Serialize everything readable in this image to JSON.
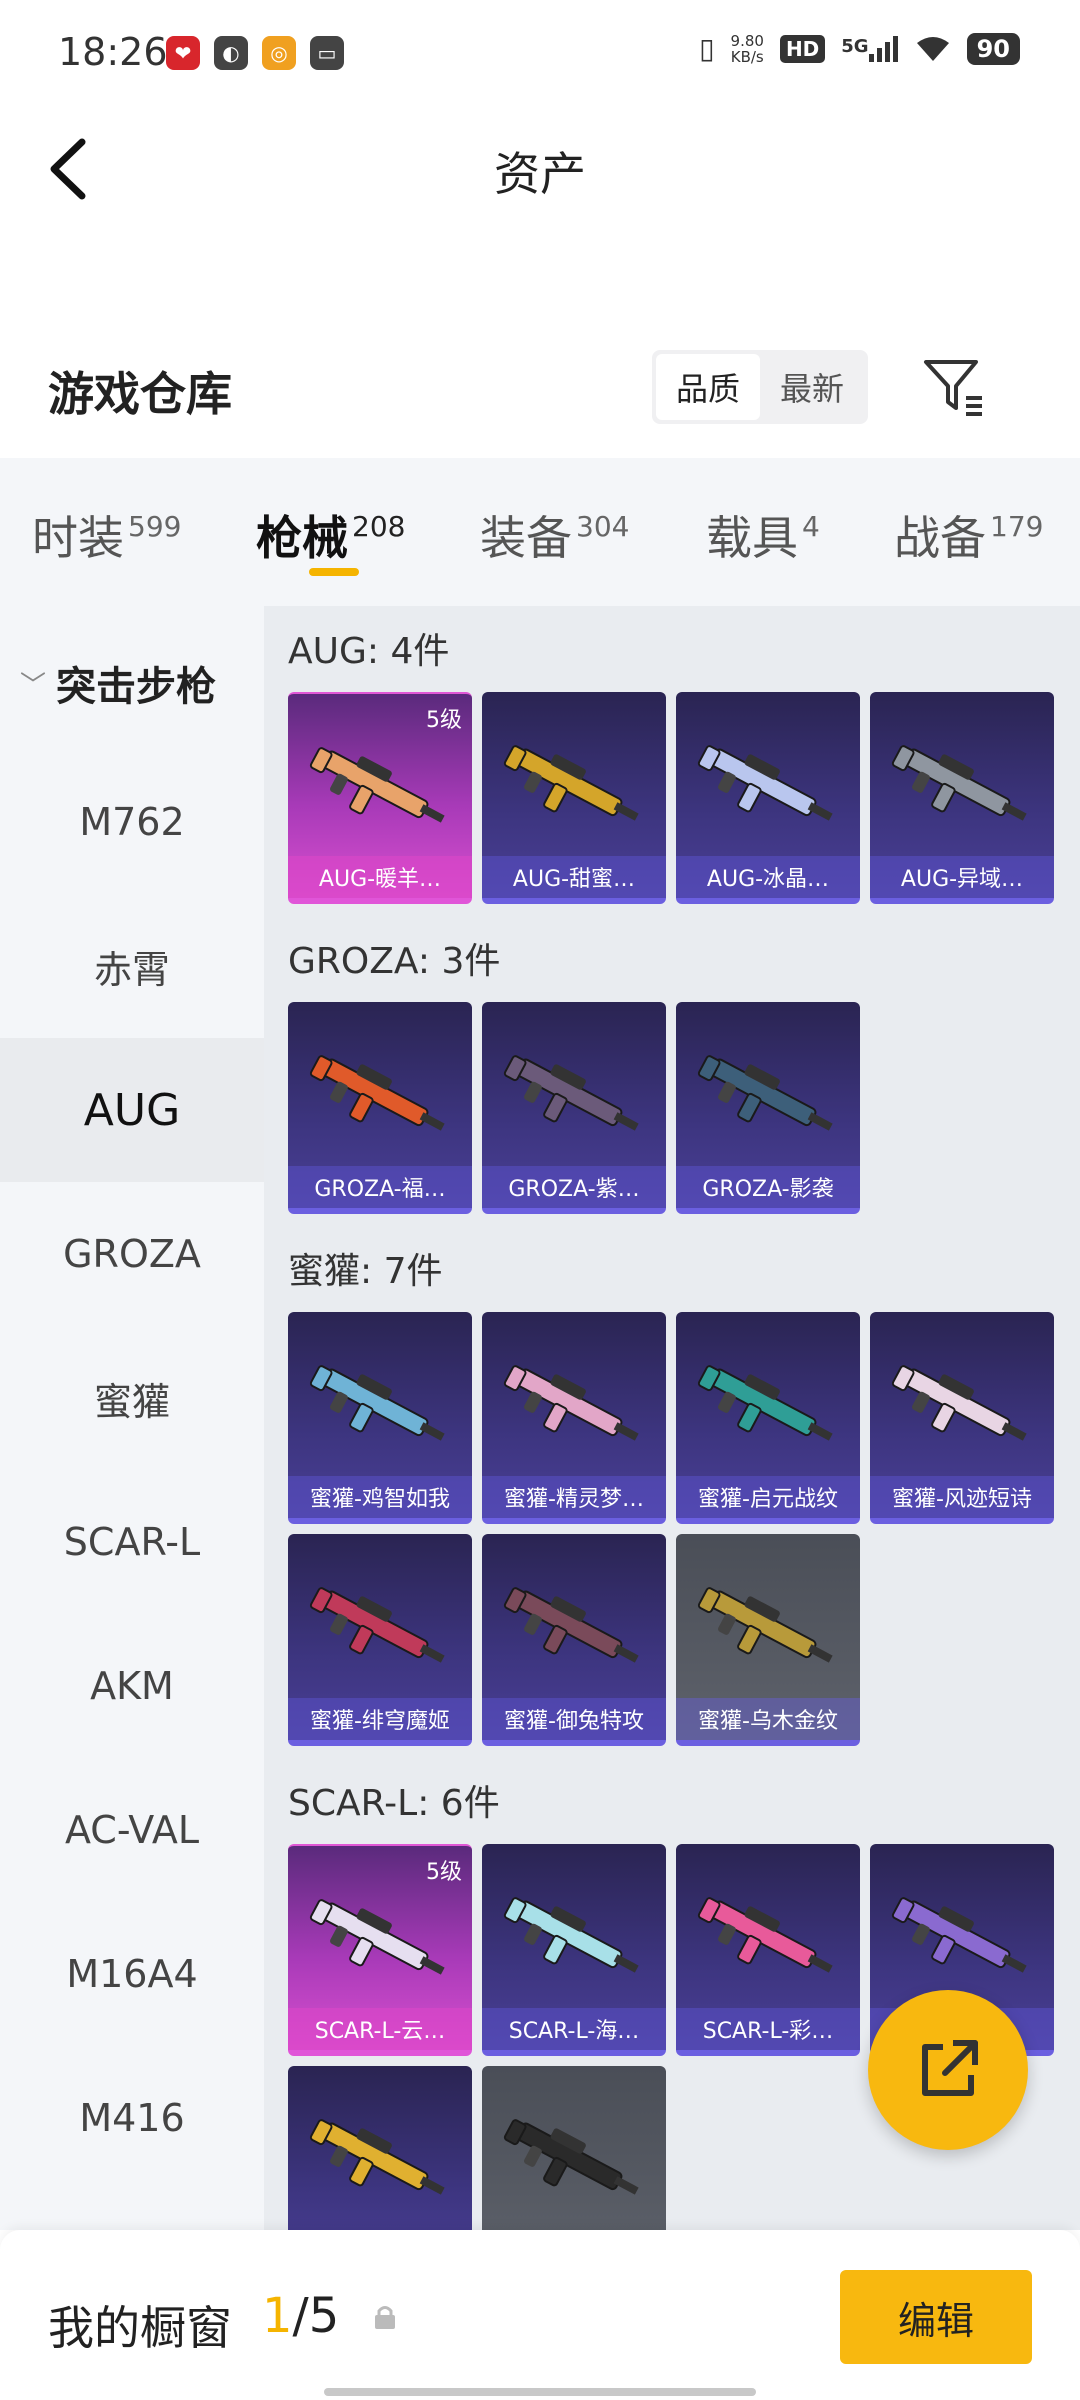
{
  "status": {
    "time": "18:26",
    "speed_value": "9.80",
    "speed_unit": "KB/s",
    "hd": "HD",
    "net": "5G",
    "battery": "90"
  },
  "header": {
    "title": "资产"
  },
  "warehouse": {
    "title": "游戏仓库",
    "sort": [
      "品质",
      "最新"
    ]
  },
  "tabs": [
    {
      "label": "时装",
      "count": "599"
    },
    {
      "label": "枪械",
      "count": "208"
    },
    {
      "label": "装备",
      "count": "304"
    },
    {
      "label": "载具",
      "count": "4"
    },
    {
      "label": "战备",
      "count": "179"
    }
  ],
  "sidebar": {
    "category": "突击步枪",
    "items": [
      "M762",
      "赤霄",
      "AUG",
      "GROZA",
      "蜜獾",
      "SCAR-L",
      "AKM",
      "AC-VAL",
      "M16A4",
      "M416"
    ]
  },
  "sections": [
    {
      "title": "AUG: 4件",
      "items": [
        {
          "label": "AUG-暖羊…",
          "level": "5级",
          "rarity": "pink",
          "color": "#e8a36a"
        },
        {
          "label": "AUG-甜蜜…",
          "level": "",
          "rarity": "purple",
          "color": "#d4a52a"
        },
        {
          "label": "AUG-冰晶…",
          "level": "",
          "rarity": "purple",
          "color": "#b9c6ee"
        },
        {
          "label": "AUG-异域…",
          "level": "",
          "rarity": "purple",
          "color": "#8f96a0"
        }
      ]
    },
    {
      "title": "GROZA: 3件",
      "items": [
        {
          "label": "GROZA-福…",
          "level": "",
          "rarity": "purple",
          "color": "#e05a2a"
        },
        {
          "label": "GROZA-紫…",
          "level": "",
          "rarity": "purple",
          "color": "#6b5a7a"
        },
        {
          "label": "GROZA-影袭",
          "level": "",
          "rarity": "purple",
          "color": "#3d5f7a"
        }
      ]
    },
    {
      "title": "蜜獾: 7件",
      "items": [
        {
          "label": "蜜獾-鸡智如我",
          "level": "",
          "rarity": "purple",
          "color": "#6fb3d6"
        },
        {
          "label": "蜜獾-精灵梦…",
          "level": "",
          "rarity": "purple",
          "color": "#e2a6c8"
        },
        {
          "label": "蜜獾-启元战纹",
          "level": "",
          "rarity": "purple",
          "color": "#2f9e96"
        },
        {
          "label": "蜜獾-风迹短诗",
          "level": "",
          "rarity": "purple",
          "color": "#e8d5e4"
        },
        {
          "label": "蜜獾-绯穹魔姬",
          "level": "",
          "rarity": "purple",
          "color": "#c03a5a"
        },
        {
          "label": "蜜獾-御兔特攻",
          "level": "",
          "rarity": "purple",
          "color": "#7a4a5a"
        },
        {
          "label": "蜜獾-乌木金纹",
          "level": "",
          "rarity": "gray",
          "color": "#b89a3a"
        }
      ]
    },
    {
      "title": "SCAR-L: 6件",
      "items": [
        {
          "label": "SCAR-L-云…",
          "level": "5级",
          "rarity": "pink",
          "color": "#e6dff0"
        },
        {
          "label": "SCAR-L-海…",
          "level": "",
          "rarity": "purple",
          "color": "#a8e0e8"
        },
        {
          "label": "SCAR-L-彩…",
          "level": "",
          "rarity": "purple",
          "color": "#e85a9a"
        },
        {
          "label": "…",
          "level": "",
          "rarity": "purple",
          "color": "#8a6ad0"
        },
        {
          "label": "",
          "level": "",
          "rarity": "purple",
          "color": "#e0b030"
        },
        {
          "label": "",
          "level": "",
          "rarity": "gray",
          "color": "#2a2a2a"
        }
      ]
    }
  ],
  "bottom": {
    "title": "我的橱窗",
    "current": "1",
    "total": "/5",
    "edit": "编辑"
  },
  "colors": {
    "accent": "#f8b80f",
    "tab_underline": "#f5b400"
  }
}
